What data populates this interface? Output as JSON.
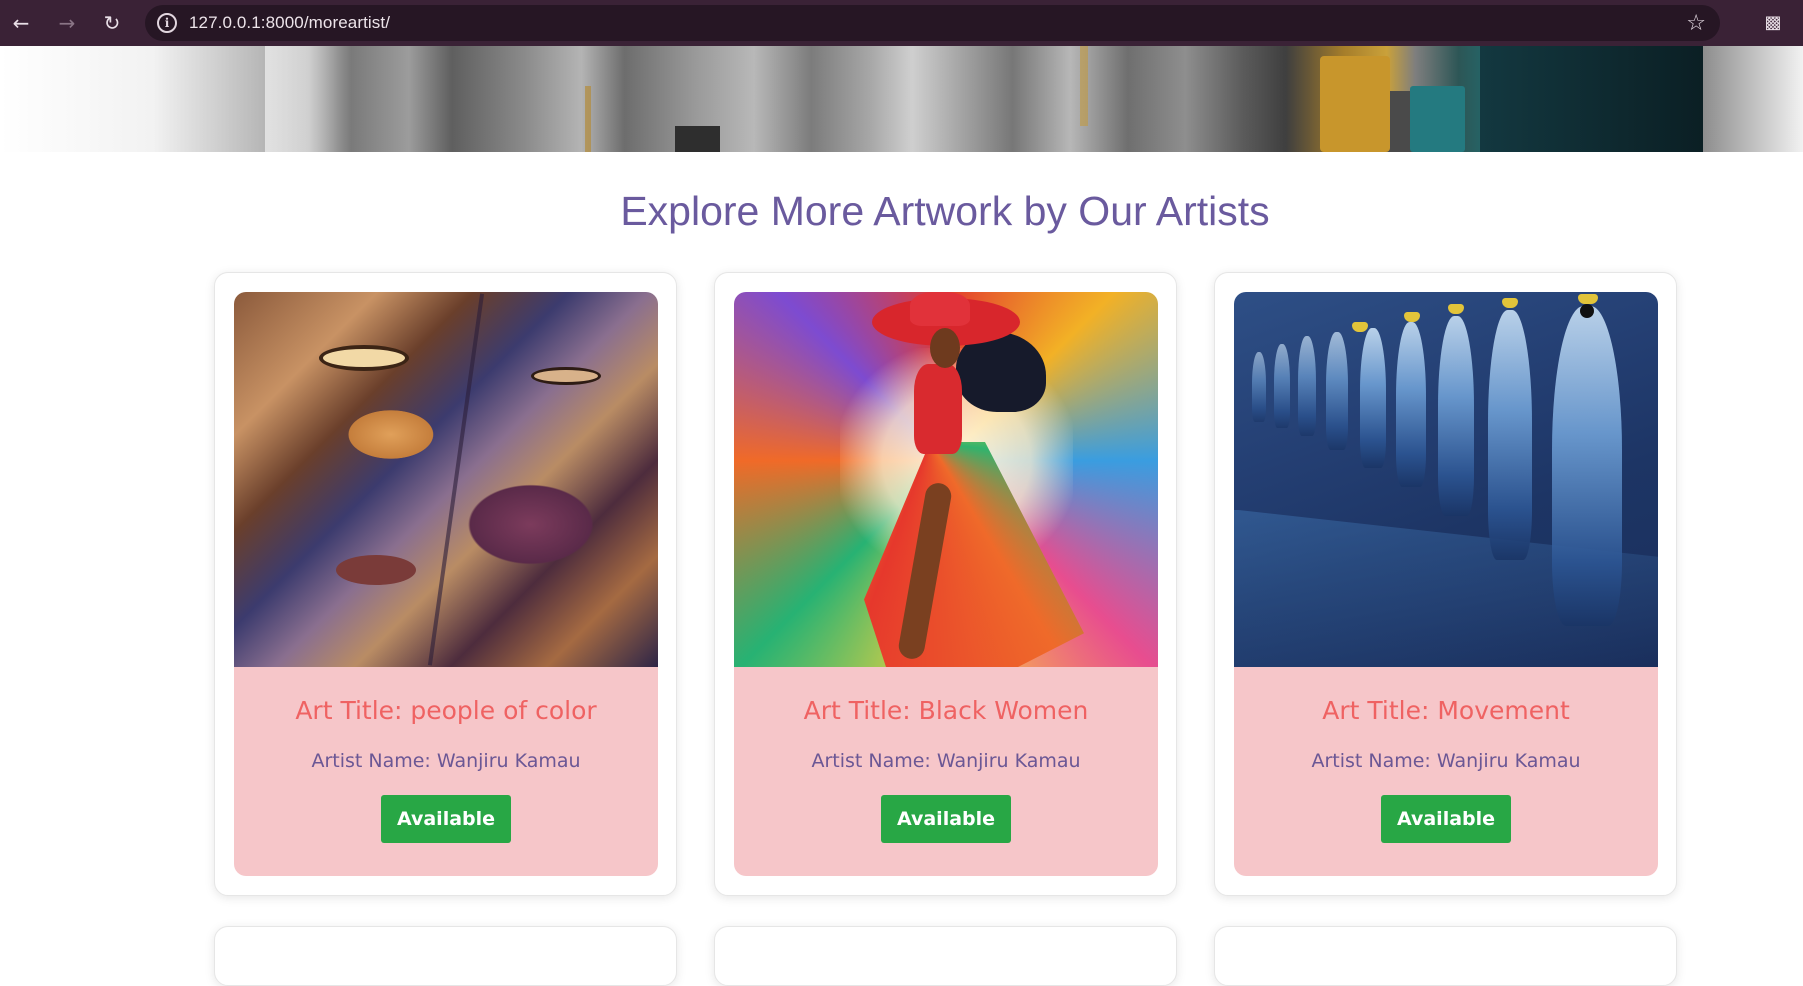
{
  "browser": {
    "url": "127.0.0.1:8000/moreartist/",
    "icons": [
      "back-arrow-icon",
      "forward-arrow-icon",
      "reload-icon",
      "info-icon",
      "star-icon",
      "extensions-icon"
    ]
  },
  "page": {
    "title": "Explore More Artwork by Our Artists"
  },
  "artworks": [
    {
      "title": "Art Title: people of color",
      "artist": "Artist Name: Wanjiru Kamau",
      "status": "Available"
    },
    {
      "title": "Art Title: Black Women",
      "artist": "Artist Name: Wanjiru Kamau",
      "status": "Available"
    },
    {
      "title": "Art Title: Movement",
      "artist": "Artist Name: Wanjiru Kamau",
      "status": "Available"
    }
  ],
  "colors": {
    "heading": "#6a5a9e",
    "card_info_bg": "#f6c6c9",
    "art_title": "#ef6262",
    "artist_name": "#6b5795",
    "status_button": "#28a745",
    "browser_bar": "#3a2236"
  }
}
